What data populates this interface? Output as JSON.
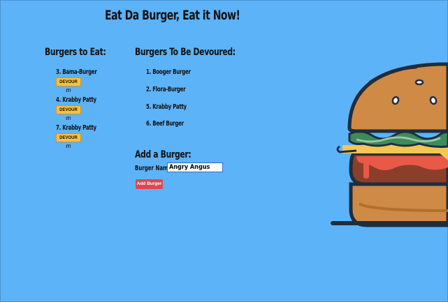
{
  "header": {
    "title": "Eat Da Burger, Eat it Now!"
  },
  "to_eat": {
    "heading": "Burgers to Eat:",
    "button_label": "DEVOUR IT!",
    "items": [
      {
        "label": "3. Bama-Burger"
      },
      {
        "label": "4. Krabby Patty"
      },
      {
        "label": "7. Krabby Patty"
      }
    ]
  },
  "devoured": {
    "heading": "Burgers To Be Devoured:",
    "items": [
      {
        "label": "1. Booger Burger"
      },
      {
        "label": "2. Flora-Burger"
      },
      {
        "label": "5. Krabby Patty"
      },
      {
        "label": "6. Beef Burger"
      }
    ]
  },
  "add_form": {
    "heading": "Add a Burger:",
    "name_label": "Burger Name:",
    "name_value": "Angry Angus",
    "submit_label": "Add Burger"
  },
  "hero": {
    "icon": "burger-illustration"
  },
  "colors": {
    "background": "#5db3f8",
    "devour": "#f6c142",
    "add": "#d9484f"
  }
}
